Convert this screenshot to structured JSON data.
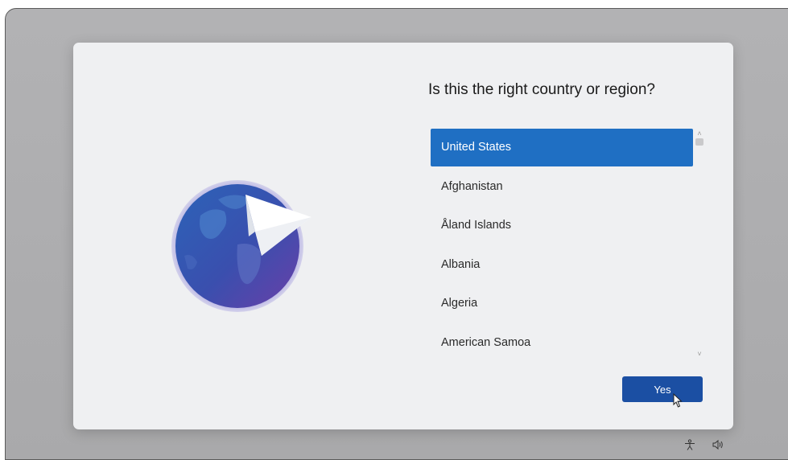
{
  "dialog": {
    "title": "Is this the right country or region?",
    "countries": [
      "United States",
      "Afghanistan",
      "Åland Islands",
      "Albania",
      "Algeria",
      "American Samoa"
    ],
    "selected_country": "United States",
    "confirm_label": "Yes"
  },
  "illustration": {
    "icon": "globe-with-paper-plane-icon"
  },
  "taskbar": {
    "icons": [
      "accessibility-icon",
      "volume-icon"
    ]
  },
  "colors": {
    "accent": "#1f6fc3",
    "button": "#1b4fa3",
    "dialog_bg": "#eff0f2",
    "desktop_bg": "#aeaeb0"
  }
}
